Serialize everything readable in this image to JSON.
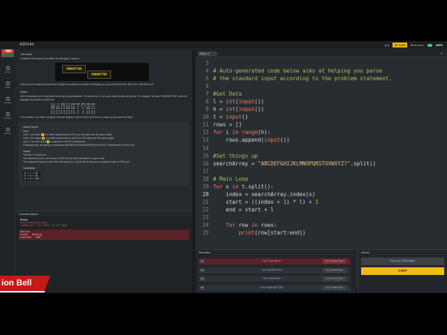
{
  "window": {
    "title": "ASCII Art"
  },
  "topbar": {
    "badge": "XP 4,310",
    "score_label": "Best score",
    "score_value": "100%"
  },
  "rail": {
    "items": [
      "Home",
      "Clash",
      "Practice",
      "Contests",
      "Discuss",
      "Settings"
    ]
  },
  "statement": {
    "goal_title": "The Goal",
    "goal_intro": "In stations and airports you often see this type of screen:",
    "image_signs": [
      "MANHATTAN",
      "MANHATTAN"
    ],
    "goal_question": "Have you ever asked yourself how it might be possible to simulate this display on a good old terminal? We have: with ASCII art!",
    "rules_title": "Rules",
    "rules_text": "ASCII art allows you to represent forms by using characters. To be precise, in our case, these forms are words. For example, the word \"MANHATTAN\" could be displayed as follows in ASCII art:",
    "ascii_art": "# #  #  ### # # ### ### ### ### ###\n### # # # # # # # #  #  #  # # # #\n### ### # # ### ###  #   #  ### # #\n# # # # # # # # # #  #   #  # # # #\n# # # # # # # # # #  #   #  # # # #",
    "mission": "Your mission is to write a program that can display a line of text in ASCII art in a style you are given as input.",
    "input_title": "Game Input",
    "input_subtitle": "Input",
    "input_lines": [
      {
        "prefix": "Line 1: the width",
        "hl": "L",
        "suffix": "of a letter represented in ASCII art. All letters are the same width."
      },
      {
        "prefix": "Line 2: the height",
        "hl": "H",
        "suffix": "of a letter represented in ASCII art. All letters are the same height."
      },
      {
        "prefix": "Line 3: The line of text",
        "hl": "T",
        "suffix": ", composed of N ASCII characters."
      },
      {
        "prefix": "Following lines: the string of characters ABCDEFGHIJKLMNOPQRSTUVWXYZ? Represented in ASCII art.",
        "hl": "",
        "suffix": ""
      }
    ],
    "output_title": "Output",
    "output_text": "The text T in ASCII art.",
    "output_text2": "The characters a to z are shown in ASCII art by their equivalent in upper case.",
    "output_text3": "The characters that are not in the intervals [a-z] or [A-Z] will be shown as a question mark in ASCII art.",
    "constraints_title": "Constraints",
    "constraints": "0 < L < 30\n0 < H < 30\n0 < N < 200"
  },
  "console": {
    "title": "Console output",
    "errors_title": "Errors",
    "error_lines": [
      "print(row[start:end])",
      "IndexError: list index out of range"
    ],
    "failure": "Failure\nFound:   Nothing\nExpected: `'###'"
  },
  "editor": {
    "language": "Python 3",
    "lines": [
      {
        "n": "3",
        "text": ""
      },
      {
        "n": "4",
        "text": "# Auto-generated code below aims at helping you parse"
      },
      {
        "n": "5",
        "text": "# the standard input according to the problem statement."
      },
      {
        "n": "6",
        "text": ""
      },
      {
        "n": "7",
        "text": "#Get Data"
      },
      {
        "n": "8",
        "text": "l = int(input())"
      },
      {
        "n": "9",
        "text": "h = int(input())"
      },
      {
        "n": "10",
        "text": "t = input()"
      },
      {
        "n": "11",
        "text": "rows = []"
      },
      {
        "n": "12",
        "text": "for i in range(h):"
      },
      {
        "n": "13",
        "text": "    rows.append(input())"
      },
      {
        "n": "14",
        "text": ""
      },
      {
        "n": "15",
        "text": "#Set things up"
      },
      {
        "n": "16",
        "text": "searchArray = \"ABCDEFGHIJKLMNOPQRSTUVWXYZ?\".split()"
      },
      {
        "n": "17",
        "text": ""
      },
      {
        "n": "18",
        "text": "# Main Loop"
      },
      {
        "n": "19",
        "text": "for x in t.split():"
      },
      {
        "n": "20",
        "text": "    index = searchArray.index(x)"
      },
      {
        "n": "21",
        "text": "    start = ((index + 1) * l) + 1"
      },
      {
        "n": "22",
        "text": "    end = start + l"
      },
      {
        "n": "23",
        "text": ""
      },
      {
        "n": "24",
        "text": "    for row in rows:"
      },
      {
        "n": "25",
        "text": "        print(row[start:end])"
      }
    ]
  },
  "tests": {
    "title": "Test cases",
    "items": [
      {
        "num": "01",
        "name": "Test 1 One letter E",
        "button": "PLAY TESTCASE",
        "status": "fail"
      },
      {
        "num": "02",
        "name": "Test 2 MANHATTAN",
        "button": "PLAY TESTCASE",
        "status": "idle"
      },
      {
        "num": "03",
        "name": "Test 3 ManhAtTan",
        "button": "PLAY TESTCASE",
        "status": "idle"
      },
      {
        "num": "04",
        "name": "Test 4 M@NH@TT@N",
        "button": "PLAY TESTCASE",
        "status": "idle"
      }
    ]
  },
  "actions": {
    "title": "Actions",
    "play_all": "PLAY ALL TESTCASES",
    "submit": "SUBMIT"
  },
  "overlay": {
    "lower_third": "ion Bell"
  },
  "colors": {
    "accent": "#f2bb13",
    "fail_row": "#5a2227",
    "idle_row": "#2d3236",
    "keyword": "#ff7b5c",
    "comment": "#a3c45a",
    "string": "#e6c07b",
    "number": "#f2bb13",
    "lower_third": "#c41a17"
  }
}
